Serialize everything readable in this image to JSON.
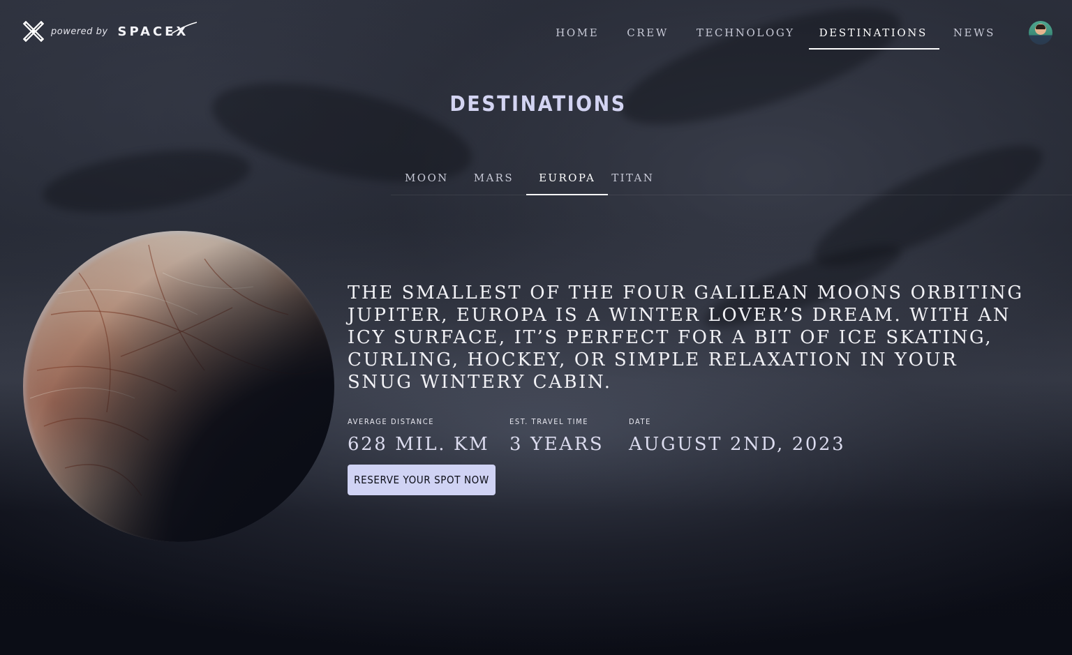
{
  "brand": {
    "logo_icon": "x-mark-icon",
    "powered_by": "powered by",
    "name": "SPACEX"
  },
  "nav": {
    "items": [
      {
        "label": "HOME",
        "active": false
      },
      {
        "label": "CREW",
        "active": false
      },
      {
        "label": "TECHNOLOGY",
        "active": false
      },
      {
        "label": "DESTINATIONS",
        "active": true
      },
      {
        "label": "NEWS",
        "active": false
      }
    ],
    "avatar_icon": "user-avatar"
  },
  "page": {
    "title": "DESTINATIONS"
  },
  "destinations": {
    "tabs": [
      {
        "label": "MOON",
        "active": false
      },
      {
        "label": "MARS",
        "active": false
      },
      {
        "label": "EUROPA",
        "active": true
      },
      {
        "label": "TITAN",
        "active": false
      }
    ],
    "selected": {
      "description": "THE SMALLEST OF THE FOUR GALILEAN MOONS ORBITING JUPITER, EUROPA IS A WINTER LOVER’S DREAM. WITH AN ICY SURFACE, IT’S PERFECT FOR A BIT OF ICE SKATING, CURLING, HOCKEY, OR SIMPLE RELAXATION IN YOUR SNUG WINTERY CABIN.",
      "stats": [
        {
          "label": "AVERAGE DISTANCE",
          "value": "628 MIL. KM"
        },
        {
          "label": "EST. TRAVEL TIME",
          "value": "3 YEARS"
        },
        {
          "label": "DATE",
          "value": "AUGUST 2ND, 2023"
        }
      ],
      "cta_label": "RESERVE YOUR SPOT NOW"
    }
  },
  "colors": {
    "accent": "#d0d3f4",
    "background": "#0b0d16",
    "text": "#ffffff"
  }
}
